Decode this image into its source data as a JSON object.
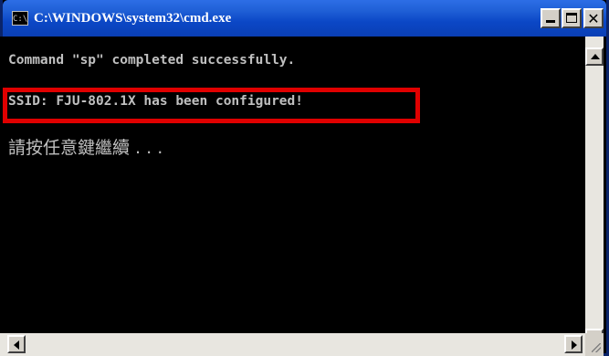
{
  "window": {
    "title": "C:\\WINDOWS\\system32\\cmd.exe",
    "icon_label": "C:\\",
    "icon": "console-icon"
  },
  "titlebar_buttons": {
    "minimize_icon": "minimize-icon",
    "maximize_icon": "maximize-icon",
    "close_icon": "close-icon",
    "close_glyph": "✕"
  },
  "console": {
    "lines": [
      "Command \"sp\" completed successfully.",
      "SSID: FJU-802.1X has been configured!",
      "請按任意鍵繼續 . . ."
    ]
  },
  "annotation": {
    "highlight_color": "#e00000"
  },
  "colors": {
    "console_background": "#000000",
    "console_text": "#c0c0c0",
    "titlebar": "#0b47c6"
  }
}
